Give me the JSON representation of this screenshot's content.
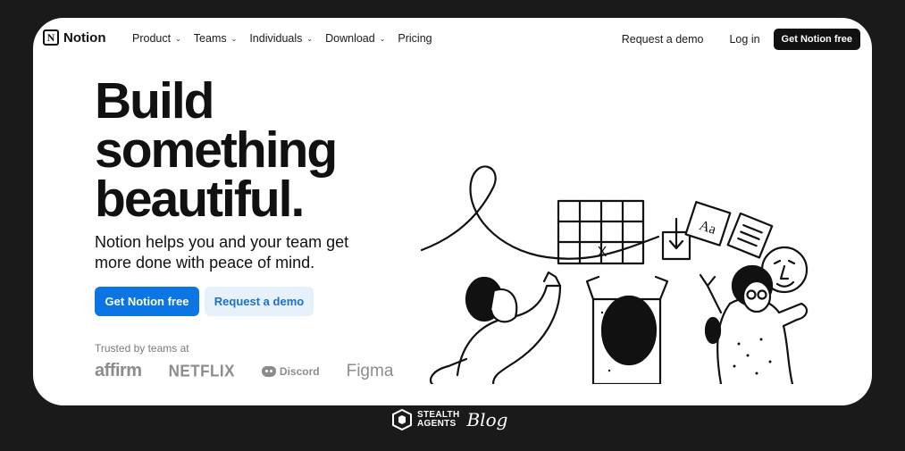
{
  "nav": {
    "brand": "Notion",
    "logo_letter": "N",
    "menu": [
      {
        "label": "Product",
        "has_dropdown": true
      },
      {
        "label": "Teams",
        "has_dropdown": true
      },
      {
        "label": "Individuals",
        "has_dropdown": true
      },
      {
        "label": "Download",
        "has_dropdown": true
      },
      {
        "label": "Pricing",
        "has_dropdown": false
      }
    ],
    "request_demo": "Request a demo",
    "login": "Log in",
    "cta": "Get Notion free"
  },
  "hero": {
    "headline_lines": [
      "Build",
      "something",
      "beautiful."
    ],
    "subheading": "Notion helps you and your team get more done with peace of mind.",
    "primary_cta": "Get Notion free",
    "secondary_cta": "Request a demo",
    "trusted_label": "Trusted by teams at",
    "trusted_logos": [
      "affirm",
      "NETFLIX",
      "Discord",
      "Figma"
    ]
  },
  "illustration": {
    "board_letter": "X",
    "card_text": "Aa"
  },
  "watermark": {
    "line1": "STEALTH",
    "line2": "AGENTS",
    "script": "Blog"
  },
  "colors": {
    "primary": "#0a75e3",
    "secondary_bg": "#e6f1fb",
    "page_bg": "#1a1a1a",
    "card_bg": "#ffffff"
  }
}
